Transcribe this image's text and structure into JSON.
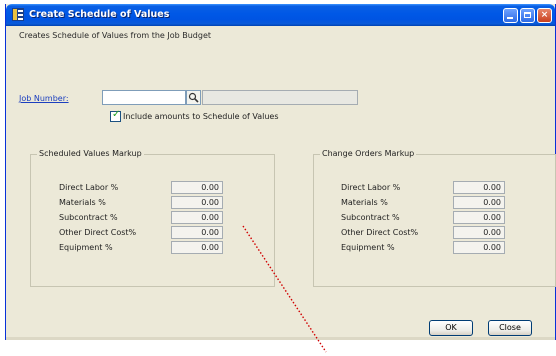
{
  "window": {
    "title": "Create Schedule of Values"
  },
  "description": "Creates Schedule of Values from the Job Budget",
  "job_number": {
    "label": "Job Number:",
    "value": "",
    "description_value": ""
  },
  "include_amounts": {
    "label": "Include amounts to Schedule of Values",
    "checked": true
  },
  "scheduled_values_markup": {
    "title": "Scheduled Values Markup",
    "fields": [
      {
        "label": "Direct Labor %",
        "value": "0.00"
      },
      {
        "label": "Materials %",
        "value": "0.00"
      },
      {
        "label": "Subcontract %",
        "value": "0.00"
      },
      {
        "label": "Other Direct Cost%",
        "value": "0.00"
      },
      {
        "label": "Equipment %",
        "value": "0.00"
      }
    ]
  },
  "change_orders_markup": {
    "title": "Change Orders Markup",
    "fields": [
      {
        "label": "Direct Labor %",
        "value": "0.00"
      },
      {
        "label": "Materials %",
        "value": "0.00"
      },
      {
        "label": "Subcontract %",
        "value": "0.00"
      },
      {
        "label": "Other Direct Cost%",
        "value": "0.00"
      },
      {
        "label": "Equipment %",
        "value": "0.00"
      }
    ]
  },
  "buttons": {
    "ok": "OK",
    "close": "Close"
  },
  "colors": {
    "title_bar": "#0054e3",
    "dialog_background": "#ece9d8",
    "link": "#1c3fbf",
    "annotation_line": "#d00000"
  },
  "icons": [
    "app-icon",
    "minimize-icon",
    "maximize-icon",
    "close-icon",
    "magnifier-icon",
    "checkmark-icon"
  ]
}
